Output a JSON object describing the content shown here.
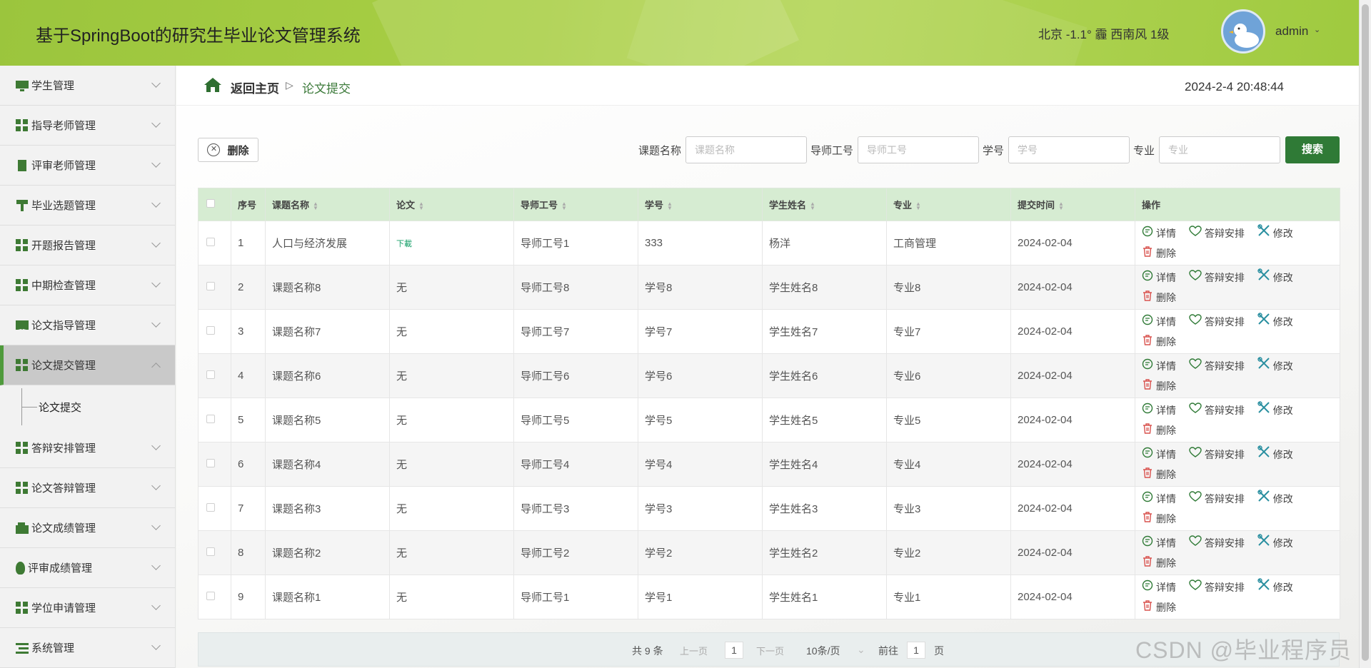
{
  "header": {
    "title": "基于SpringBoot的研究生毕业论文管理系统",
    "weather": "北京 -1.1° 霾 西南风 1级",
    "user": "admin"
  },
  "sidebar": {
    "items": [
      {
        "label": "学生管理",
        "icon": "monitor-icon"
      },
      {
        "label": "指导老师管理",
        "icon": "grid-icon"
      },
      {
        "label": "评审老师管理",
        "icon": "clipboard-icon"
      },
      {
        "label": "毕业选题管理",
        "icon": "pin-icon"
      },
      {
        "label": "开题报告管理",
        "icon": "grid-icon"
      },
      {
        "label": "中期检查管理",
        "icon": "grid-icon"
      },
      {
        "label": "论文指导管理",
        "icon": "book-icon"
      },
      {
        "label": "论文提交管理",
        "icon": "grid-icon"
      },
      {
        "label": "答辩安排管理",
        "icon": "grid-icon"
      },
      {
        "label": "论文答辩管理",
        "icon": "grid-icon"
      },
      {
        "label": "论文成绩管理",
        "icon": "wallet-icon"
      },
      {
        "label": "评审成绩管理",
        "icon": "bulb-icon"
      },
      {
        "label": "学位申请管理",
        "icon": "grid-icon"
      },
      {
        "label": "系统管理",
        "icon": "list-icon"
      }
    ],
    "sub_item": "论文提交"
  },
  "breadcrumb": {
    "home": "返回主页",
    "separator": "▷",
    "current": "论文提交"
  },
  "datetime": "2024-2-4 20:48:44",
  "toolbar": {
    "delete": "删除",
    "search_button": "搜索",
    "fields": [
      {
        "label": "课题名称",
        "placeholder": "课题名称"
      },
      {
        "label": "导师工号",
        "placeholder": "导师工号"
      },
      {
        "label": "学号",
        "placeholder": "学号"
      },
      {
        "label": "专业",
        "placeholder": "专业"
      }
    ]
  },
  "table": {
    "columns": [
      "序号",
      "课题名称",
      "论文",
      "导师工号",
      "学号",
      "学生姓名",
      "专业",
      "提交时间",
      "操作"
    ],
    "actions": {
      "detail": "详情",
      "arrange": "答辩安排",
      "edit": "修改",
      "delete": "删除"
    },
    "rows": [
      {
        "no": "1",
        "title": "人口与经济发展",
        "paper": "下載",
        "tutor": "导师工号1",
        "sid": "333",
        "name": "杨洋",
        "major": "工商管理",
        "time": "2024-02-04"
      },
      {
        "no": "2",
        "title": "课题名称8",
        "paper": "无",
        "tutor": "导师工号8",
        "sid": "学号8",
        "name": "学生姓名8",
        "major": "专业8",
        "time": "2024-02-04"
      },
      {
        "no": "3",
        "title": "课题名称7",
        "paper": "无",
        "tutor": "导师工号7",
        "sid": "学号7",
        "name": "学生姓名7",
        "major": "专业7",
        "time": "2024-02-04"
      },
      {
        "no": "4",
        "title": "课题名称6",
        "paper": "无",
        "tutor": "导师工号6",
        "sid": "学号6",
        "name": "学生姓名6",
        "major": "专业6",
        "time": "2024-02-04"
      },
      {
        "no": "5",
        "title": "课题名称5",
        "paper": "无",
        "tutor": "导师工号5",
        "sid": "学号5",
        "name": "学生姓名5",
        "major": "专业5",
        "time": "2024-02-04"
      },
      {
        "no": "6",
        "title": "课题名称4",
        "paper": "无",
        "tutor": "导师工号4",
        "sid": "学号4",
        "name": "学生姓名4",
        "major": "专业4",
        "time": "2024-02-04"
      },
      {
        "no": "7",
        "title": "课题名称3",
        "paper": "无",
        "tutor": "导师工号3",
        "sid": "学号3",
        "name": "学生姓名3",
        "major": "专业3",
        "time": "2024-02-04"
      },
      {
        "no": "8",
        "title": "课题名称2",
        "paper": "无",
        "tutor": "导师工号2",
        "sid": "学号2",
        "name": "学生姓名2",
        "major": "专业2",
        "time": "2024-02-04"
      },
      {
        "no": "9",
        "title": "课题名称1",
        "paper": "无",
        "tutor": "导师工号1",
        "sid": "学号1",
        "name": "学生姓名1",
        "major": "专业1",
        "time": "2024-02-04"
      }
    ]
  },
  "pagination": {
    "total": "共 9 条",
    "prev": "上一页",
    "page": "1",
    "next": "下一页",
    "page_size": "10条/页",
    "goto_label": "前往",
    "goto_page": "1",
    "goto_suffix": "页"
  },
  "watermark": "CSDN @毕业程序员"
}
